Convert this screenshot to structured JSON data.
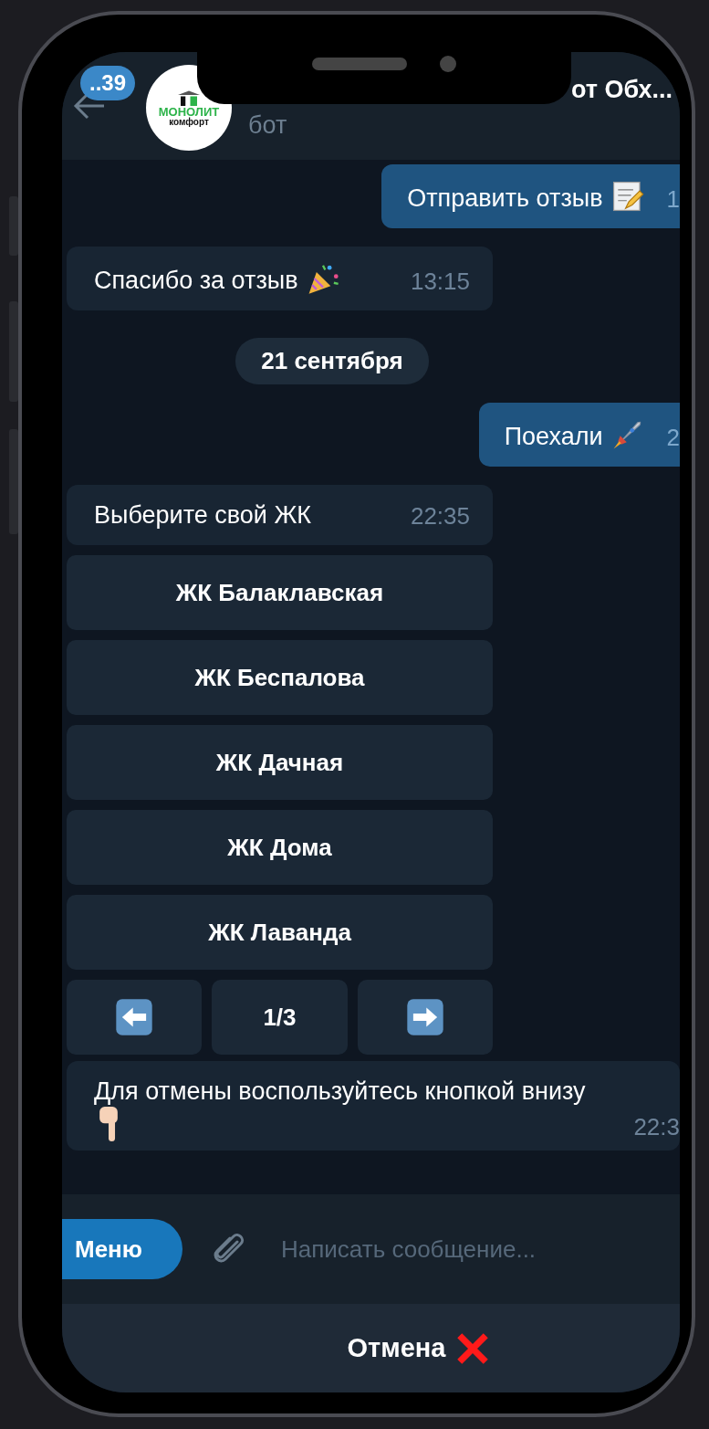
{
  "header": {
    "unread_badge": "..39",
    "title": "от Обх...",
    "subtitle": "бот",
    "logo": {
      "line1": "МОНОЛИТ",
      "line2": "комфорт"
    }
  },
  "messages": [
    {
      "kind": "outgoing",
      "text": "Отправить отзыв",
      "time": "1"
    },
    {
      "kind": "incoming",
      "text": "Спасибо за отзыв",
      "time": "13:15"
    },
    {
      "kind": "date",
      "text": "21 сентября"
    },
    {
      "kind": "outgoing",
      "text": "Поехали",
      "time": "2"
    },
    {
      "kind": "incoming",
      "text": "Выберите свой ЖК",
      "time": "22:35",
      "keyboard": [
        "ЖК Балаклавская",
        "ЖК Беспалова",
        "ЖК Дачная",
        "ЖК Дома",
        "ЖК Лаванда"
      ],
      "pager": "1/3"
    },
    {
      "kind": "incoming",
      "text": "Для отмены воспользуйтесь кнопкой внизу",
      "time": "22:3"
    }
  ],
  "composer": {
    "menu_button": "Меню",
    "placeholder": "Написать сообщение..."
  },
  "reply_keyboard": {
    "label": "Отмена"
  }
}
